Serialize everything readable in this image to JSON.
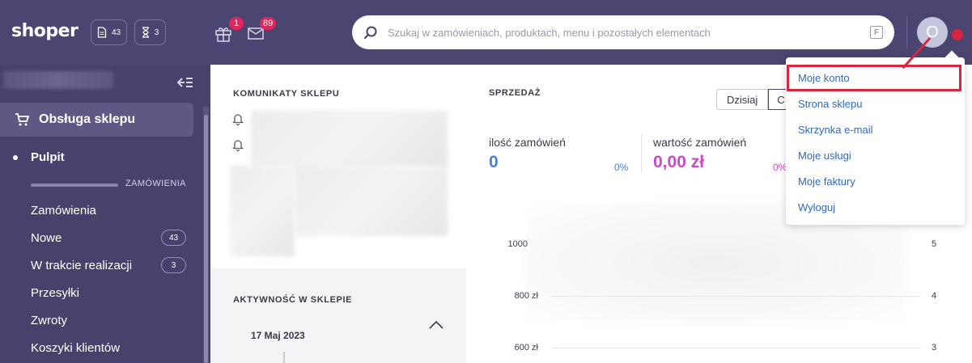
{
  "header": {
    "logo": "shoper",
    "orders_count": "43",
    "pending_count": "3",
    "gifts_badge": "1",
    "mail_badge": "89",
    "search_placeholder": "Szukaj w zamówieniach, produktach, menu i pozostałych elementach",
    "search_shortcut": "F",
    "avatar_letter": "O"
  },
  "sidebar": {
    "active_section": "Obsługa sklepu",
    "items": [
      {
        "label": "Pulpit"
      },
      {
        "section": "ZAMÓWIENIA"
      },
      {
        "label": "Zamówienia"
      },
      {
        "label": "Nowe",
        "count": "43"
      },
      {
        "label": "W trakcie realizacji",
        "count": "3"
      },
      {
        "label": "Przesyłki"
      },
      {
        "label": "Zwroty"
      },
      {
        "label": "Koszyki klientów"
      }
    ]
  },
  "panels": {
    "messages_title": "KOMUNIKATY SKLEPU",
    "activity_title": "AKTYWNOŚĆ W SKLEPIE",
    "activity_date": "17 Maj 2023"
  },
  "sales": {
    "title": "SPRZEDAŻ",
    "period_today": "Dzisiaj",
    "period_second_partial": "C",
    "orders_count_label": "ilość zamówień",
    "orders_count_value": "0",
    "orders_count_pct": "0%",
    "orders_value_label": "wartość zamówień",
    "orders_value_value": "0,00 zł",
    "orders_value_pct": "0%",
    "orders_count_color": "#4a7fd4",
    "orders_value_color": "#c84bc4"
  },
  "chart_data": {
    "type": "line",
    "y_left_ticks": [
      "1000",
      "800 zł",
      "600 zł"
    ],
    "y_right_ticks": [
      "5",
      "4",
      "3"
    ]
  },
  "account_menu": {
    "items": [
      "Moje konto",
      "Strona sklepu",
      "Skrzynka e-mail",
      "Moje usługi",
      "Moje faktury",
      "Wyloguj"
    ]
  },
  "colors": {
    "topbar": "#4b4571",
    "sidebar": "#48416c",
    "link": "#2f68c2",
    "highlight": "#d7263d",
    "badge": "#e0245e"
  }
}
